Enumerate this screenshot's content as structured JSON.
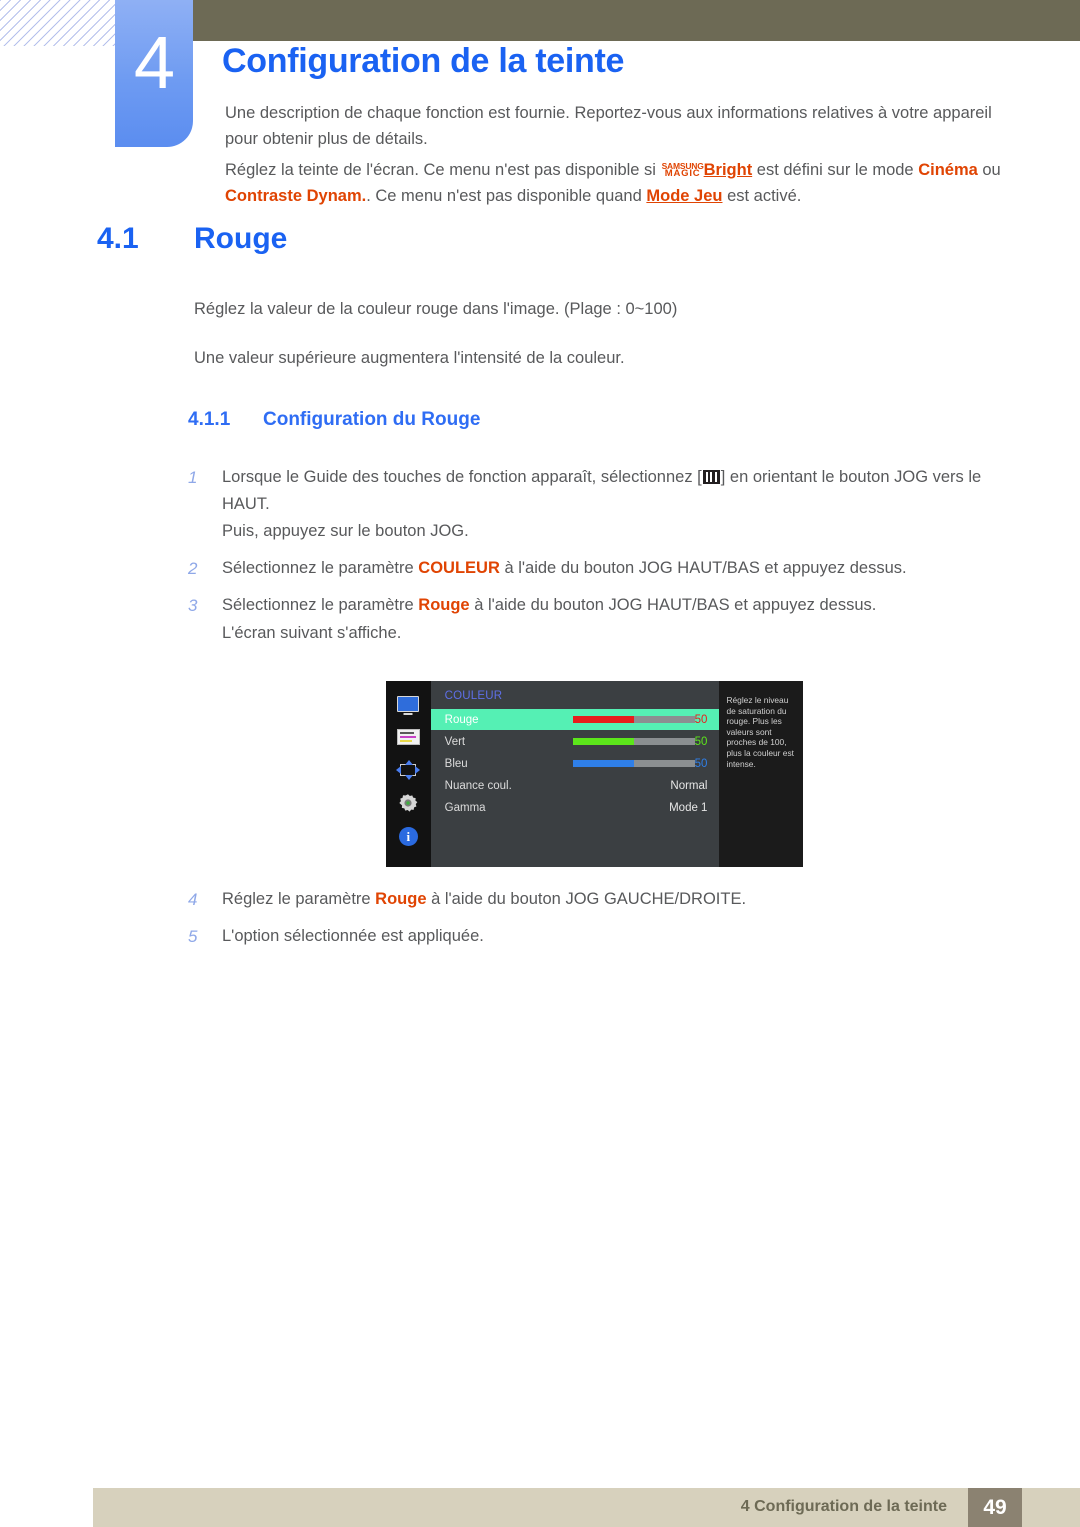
{
  "header": {
    "chapter_number": "4",
    "title": "Configuration de la teinte",
    "intro_1": "Une description de chaque fonction est fournie. Reportez-vous aux informations relatives à votre appareil pour obtenir plus de détails.",
    "intro_2_a": "Réglez la teinte de l'écran. Ce menu n'est pas disponible si ",
    "magic_line1": "SAMSUNG",
    "magic_line2": "MAGIC",
    "magic_bright": "Bright",
    "intro_2_b": " est défini sur le mode ",
    "mode_cinema": "Cinéma",
    "intro_2_c": " ou ",
    "mode_contraste": "Contraste Dynam.",
    "intro_2_d": ". Ce menu n'est pas disponible quand ",
    "mode_jeu": "Mode Jeu",
    "intro_2_e": " est activé."
  },
  "section": {
    "number": "4.1",
    "title": "Rouge",
    "para_range": "Réglez la valeur de la couleur rouge dans l'image. (Plage : 0~100)",
    "para_more": "Une valeur supérieure augmentera l'intensité de la couleur."
  },
  "subsection": {
    "number": "4.1.1",
    "title": "Configuration du Rouge"
  },
  "steps": [
    {
      "index": "1",
      "text_a": "Lorsque le Guide des touches de fonction apparaît, sélectionnez [",
      "text_b": "] en orientant le bouton JOG vers le HAUT.",
      "sub": "Puis, appuyez sur le bouton JOG."
    },
    {
      "index": "2",
      "text_a": "Sélectionnez le paramètre ",
      "highlight": "COULEUR",
      "text_b": " à l'aide du bouton JOG HAUT/BAS et appuyez dessus."
    },
    {
      "index": "3",
      "text_a": "Sélectionnez le paramètre ",
      "highlight": "Rouge",
      "text_b": " à l'aide du bouton JOG HAUT/BAS et appuyez dessus.",
      "sub": "L'écran suivant s'affiche."
    },
    {
      "index": "4",
      "text_a": "Réglez le paramètre ",
      "highlight": "Rouge",
      "text_b": " à l'aide du bouton JOG GAUCHE/DROITE."
    },
    {
      "index": "5",
      "text_a": "L'option sélectionnée est appliquée."
    }
  ],
  "osd": {
    "heading": "COULEUR",
    "sidebar_icons": [
      "monitor-icon",
      "picture-sliders-icon",
      "four-way-arrows-icon",
      "gear-icon",
      "info-icon"
    ],
    "rows": [
      {
        "label": "Rouge",
        "value": "50",
        "type": "slider",
        "fill_percent": 50,
        "color": "#e81c1c",
        "value_color": "#e81c1c",
        "selected": true
      },
      {
        "label": "Vert",
        "value": "50",
        "type": "slider",
        "fill_percent": 50,
        "color": "#5ce61b",
        "value_color": "#5ce61b",
        "selected": false
      },
      {
        "label": "Bleu",
        "value": "50",
        "type": "slider",
        "fill_percent": 50,
        "color": "#2f7fe8",
        "value_color": "#2f7fe8",
        "selected": false
      },
      {
        "label": "Nuance coul.",
        "value": "Normal",
        "type": "text",
        "selected": false
      },
      {
        "label": "Gamma",
        "value": "Mode 1",
        "type": "text",
        "selected": false
      }
    ],
    "help_text": "Réglez le niveau de saturation du rouge. Plus les valeurs sont proches de 100, plus la couleur est intense."
  },
  "footer": {
    "text": "4 Configuration de la teinte",
    "page": "49"
  },
  "colors": {
    "accent_blue": "#1a62f2",
    "highlight_orange": "#e04403",
    "topbar_olive": "#6d6a55",
    "footer_beige": "#d7d1bd",
    "footer_page_box": "#8b8271",
    "osd_selected_green": "#55f0b4"
  }
}
